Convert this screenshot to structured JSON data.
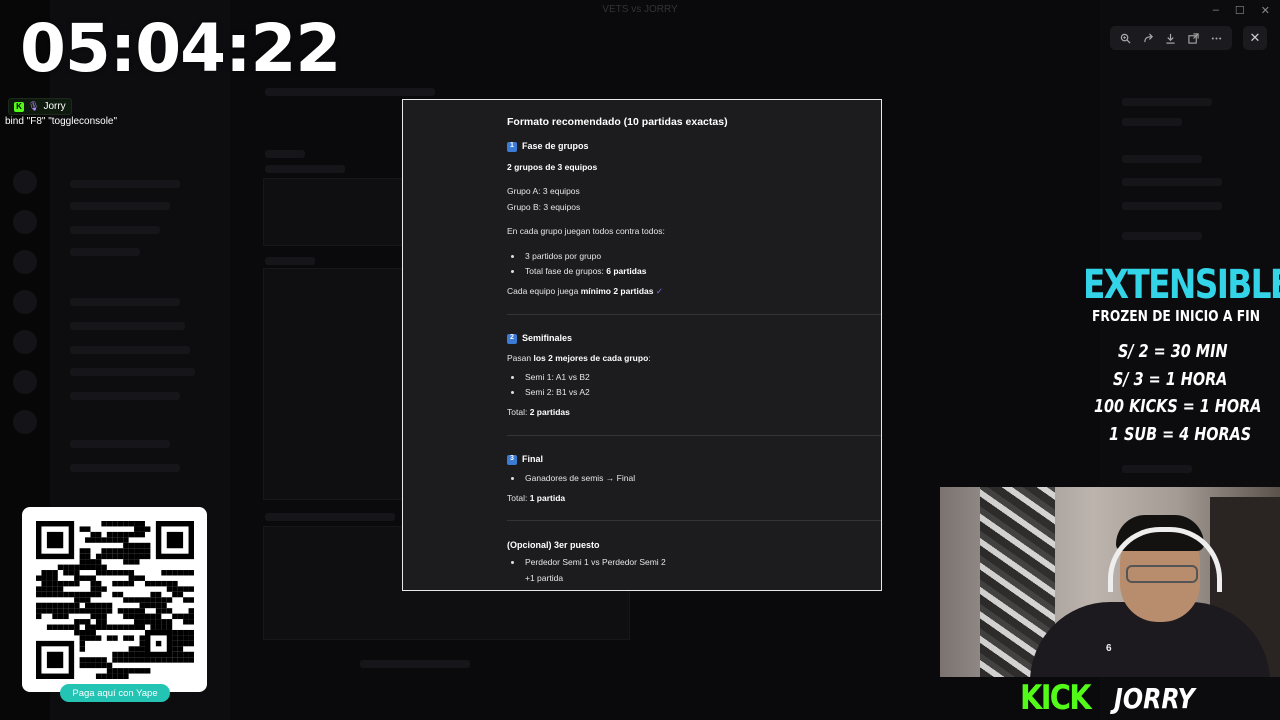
{
  "window": {
    "title": "VETS vs JORRY"
  },
  "overlay": {
    "timer": "05:04:22",
    "badge_name": "Jorry",
    "console_bind": "bind \"F8\" \"toggleconsole\""
  },
  "viewer": {
    "toolbar_icons": [
      "zoom-in-icon",
      "forward-icon",
      "download-icon",
      "open-external-icon",
      "more-icon"
    ],
    "close_icon": "close-icon"
  },
  "doc": {
    "title": "Formato recomendado (10 partidas exactas)",
    "s1": {
      "num": "1",
      "heading": "Fase de grupos",
      "subtitle": "2 grupos de 3 equipos",
      "line1": "Grupo A: 3 equipos",
      "line2": "Grupo B: 3 equipos",
      "intro": "En cada grupo juegan todos contra todos:",
      "b1": "3 partidos por grupo",
      "b2_prefix": "Total fase de grupos: ",
      "b2_bold": "6 partidas",
      "note_prefix": "Cada equipo juega ",
      "note_bold": "mínimo 2 partidas",
      "check": "✓"
    },
    "s2": {
      "num": "2",
      "heading": "Semifinales",
      "intro_prefix": "Pasan ",
      "intro_bold": "los 2 mejores de cada grupo",
      "intro_suffix": ":",
      "b1": "Semi 1: A1 vs B2",
      "b2": "Semi 2: B1 vs A2",
      "total_prefix": "Total: ",
      "total_bold": "2 partidas"
    },
    "s3": {
      "num": "3",
      "heading": "Final",
      "b1": "Ganadores de semis → Final",
      "total_prefix": "Total: ",
      "total_bold": "1 partida"
    },
    "s4": {
      "heading": "(Opcional) 3er puesto",
      "b1": "Perdedor Semi 1 vs Perdedor Semi 2",
      "extra": "+1 partida"
    }
  },
  "promo": {
    "title": "EXTENSIBLE",
    "subtitle": "FROZEN DE INICIO A FIN",
    "lines": [
      "S/ 2 = 30 MIN",
      "S/ 3  = 1 HORA",
      "100 KICKS = 1 HORA",
      "1 SUB = 4 HORAS"
    ]
  },
  "branding": {
    "platform": "KICK",
    "username": "JORRY"
  },
  "qr": {
    "button_label": "Paga aquí con Yape"
  },
  "colors": {
    "kick_green": "#53fc18",
    "promo_cyan": "#34d4e8",
    "yape_teal": "#23c4b3"
  }
}
